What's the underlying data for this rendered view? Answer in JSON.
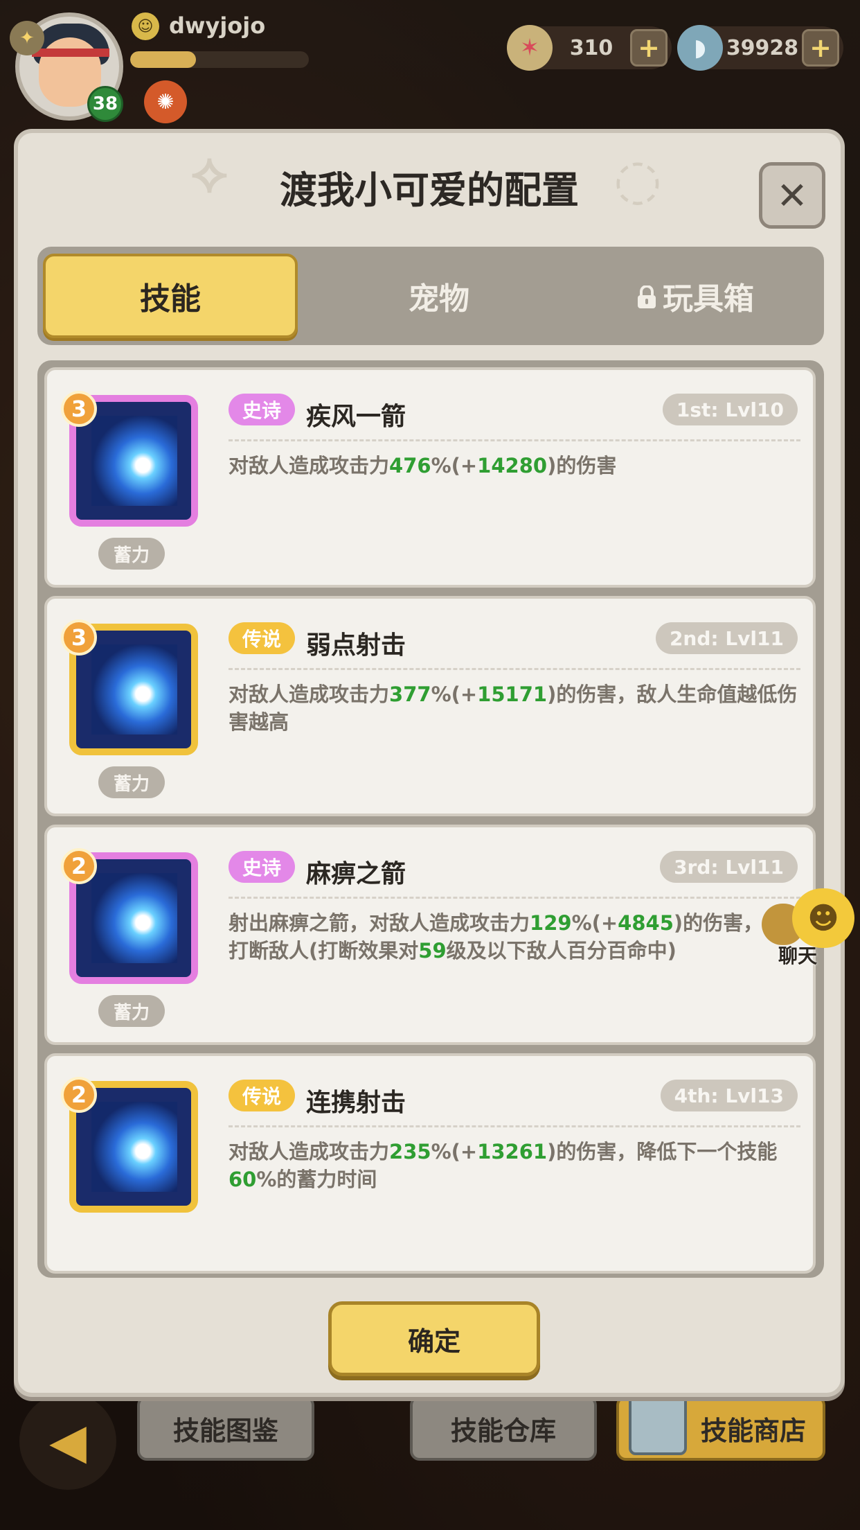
{
  "header": {
    "player_name": "dwyjojo",
    "level": "38",
    "xp_progress": 0.37,
    "currency_gems": "310",
    "currency_coins": "39928",
    "plus_label": "+"
  },
  "dialog": {
    "title": "渡我小可爱的配置",
    "close_label": "✕",
    "tabs": [
      {
        "label": "技能"
      },
      {
        "label": "宠物"
      },
      {
        "label": "玩具箱"
      }
    ],
    "confirm_label": "确定"
  },
  "skills": [
    {
      "stars": "3",
      "rarity": "史诗",
      "name": "疾风一箭",
      "rank": "1st: Lvl10",
      "tag": "蓄力",
      "desc_parts": [
        "对敌人造成攻击力",
        "476",
        "%(+",
        "14280",
        ")的伤害"
      ]
    },
    {
      "stars": "3",
      "rarity": "传说",
      "name": "弱点射击",
      "rank": "2nd: Lvl11",
      "tag": "蓄力",
      "desc_parts": [
        "对敌人造成攻击力",
        "377",
        "%(+",
        "15171",
        ")的伤害，敌人生命值越低伤害越高"
      ]
    },
    {
      "stars": "2",
      "rarity": "史诗",
      "name": "麻痹之箭",
      "rank": "3rd: Lvl11",
      "tag": "蓄力",
      "desc_parts": [
        "射出麻痹之箭，对敌人造成攻击力",
        "129",
        "%(+",
        "4845",
        ")的伤害，并打断敌人(打断效果对",
        "59",
        "级及以下敌人百分百命中)"
      ]
    },
    {
      "stars": "2",
      "rarity": "传说",
      "name": "连携射击",
      "rank": "4th: Lvl13",
      "desc_parts": [
        "对敌人造成攻击力",
        "235",
        "%(+",
        "13261",
        ")的伤害，降低下一个技能",
        "60",
        "%的蓄力时间"
      ]
    }
  ],
  "chat": {
    "label": "聊天"
  },
  "bottom_nav": {
    "back_icon": "arrow-left-icon",
    "tab1": "技能图鉴",
    "tab2": "技能仓库",
    "tab3": "技能商店"
  },
  "colors": {
    "accent_yellow": "#f4d56a",
    "epic_pink": "#e388e8",
    "legend_gold": "#f4c23e",
    "highlight_green": "#2f9e32"
  }
}
